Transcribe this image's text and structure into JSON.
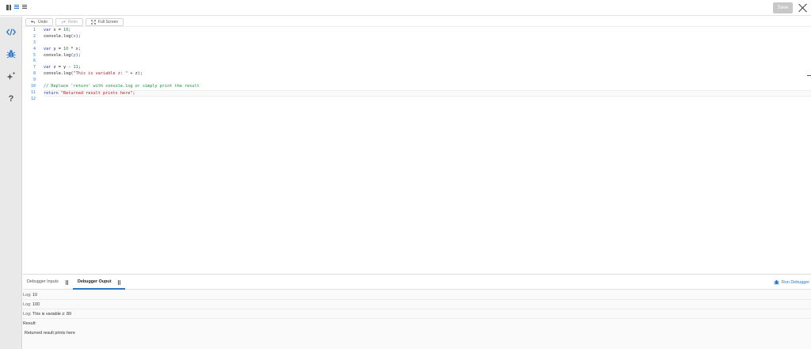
{
  "topbar": {
    "save_label": "Save"
  },
  "sidebar": {
    "items": [
      {
        "icon": "code-icon"
      },
      {
        "icon": "bug-icon"
      },
      {
        "icon": "sparkle-icon"
      },
      {
        "icon": "help-icon",
        "glyph": "?"
      }
    ]
  },
  "toolbar": {
    "undo_label": "Undo",
    "redo_label": "Redo",
    "fullscreen_label": "Full Screen"
  },
  "editor": {
    "line_numbers": [
      "1",
      "2",
      "3",
      "4",
      "5",
      "6",
      "7",
      "8",
      "9",
      "10",
      "11",
      "12"
    ],
    "active_line": 11
  },
  "panel": {
    "tab_inputs": "Debugger Inputs",
    "tab_output": "Debugger Ouput",
    "run_label": "Run Debugger",
    "logs": [
      {
        "prefix": "Log:",
        "value": "10"
      },
      {
        "prefix": "Log:",
        "value": "100"
      },
      {
        "prefix": "Log:",
        "value": "This is variable z: 89"
      }
    ],
    "result_label": "Result:",
    "result_value": "Returned result prints here"
  },
  "colors": {
    "accent": "#2b77c8",
    "keyword": "#1f3fb0",
    "number": "#1d8a3a",
    "string": "#b11a1a",
    "comment": "#1d8a3a"
  }
}
